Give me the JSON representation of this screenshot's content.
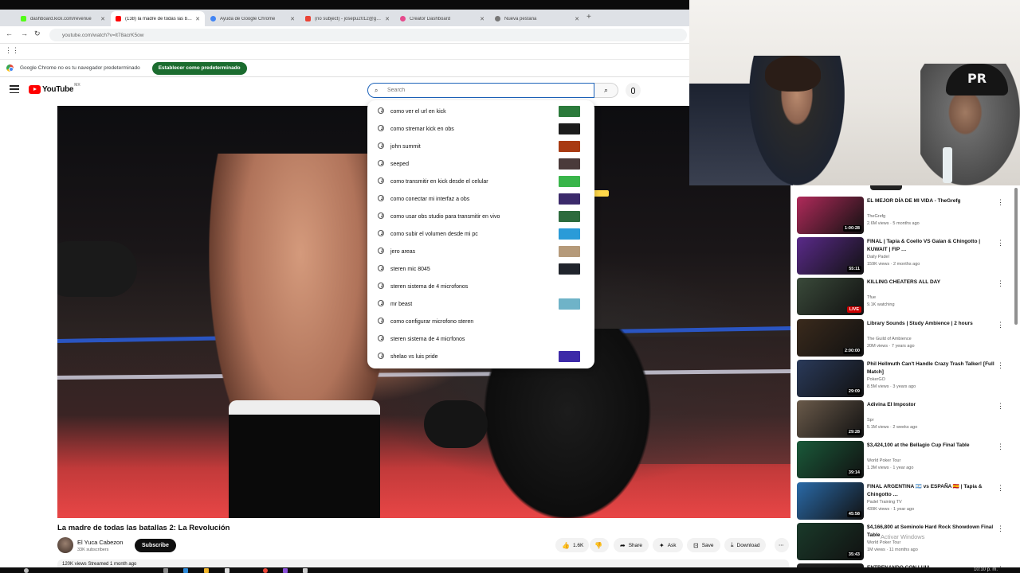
{
  "browser": {
    "tabs": [
      {
        "title": "dashboard.kick.com/revenue",
        "color": "#53fc18"
      },
      {
        "title": "(138) la madre de todas las bat…",
        "color": "#ff0000"
      },
      {
        "title": "Ayuda de Google Chrome",
        "color": "#4285f4"
      },
      {
        "title": "(no subject) - josepu2012@gm…",
        "color": "#ea4335"
      },
      {
        "title": "Creator Dashboard",
        "color": "#e64a8c"
      },
      {
        "title": "Nueva pestaña",
        "color": "#777777"
      }
    ],
    "url": "youtube.com/watch?v=lt78acrK5ow",
    "infobar": {
      "message": "Google Chrome no es tu navegador predeterminado",
      "button": "Establecer como predeterminado"
    }
  },
  "youtube": {
    "logo_text": "YouTube",
    "logo_country": "MX",
    "search": {
      "placeholder": "Search",
      "value": ""
    },
    "suggestions": [
      {
        "text": "como ver el url en kick",
        "thumb": "#2b7a3b"
      },
      {
        "text": "como stremar kick en obs",
        "thumb": "#1c1c1c"
      },
      {
        "text": "john summit",
        "thumb": "#a83a12"
      },
      {
        "text": "seeped",
        "thumb": "#4a3a3a"
      },
      {
        "text": "como transmitir en kick desde el celular",
        "thumb": "#39b54a"
      },
      {
        "text": "como conectar mi interfaz a obs",
        "thumb": "#3b2a6b"
      },
      {
        "text": "como usar obs studio para transmitir en vivo",
        "thumb": "#2d6b3d"
      },
      {
        "text": "como subir el volumen desde mi pc",
        "thumb": "#2a9bd8"
      },
      {
        "text": "jero areas",
        "thumb": "#b59a7a"
      },
      {
        "text": "steren mic 8045",
        "thumb": "#20242c"
      },
      {
        "text": "steren sistema de 4 microfonos",
        "thumb": ""
      },
      {
        "text": "mr beast",
        "thumb": "#6fb3c8"
      },
      {
        "text": "como configurar microfono steren",
        "thumb": ""
      },
      {
        "text": "steren sistema de 4 micrfonos",
        "thumb": ""
      },
      {
        "text": "shelao vs luis pride",
        "thumb": "#3d2aa8"
      }
    ],
    "video": {
      "title": "La madre de todas las batallas 2: La Revolución",
      "channel": "El Yuca Cabezon",
      "subscribers": "33K subscribers",
      "subscribe_label": "Subscribe",
      "likes": "1.6K",
      "share_label": "Share",
      "ask_label": "Ask",
      "save_label": "Save",
      "download_label": "Download",
      "views": "120K views  Streamed 1 month ago"
    },
    "recommendations": [
      {
        "title": "EL MEJOR DÍA DE MI VIDA - TheGrefg",
        "channel": "TheGrefg",
        "meta": "2.6M views · 5 months ago",
        "duration": "1:00:28",
        "thumb": "#b02a5a"
      },
      {
        "title": "FINAL | Tapia & Coello VS Galan & Chingotto | KUWAIT | FIP …",
        "channel": "Daily Padel",
        "meta": "159K views · 2 months ago",
        "duration": "55:11",
        "thumb": "#5a2a8a"
      },
      {
        "title": "KILLING CHEATERS ALL DAY",
        "channel": "Tfue",
        "meta": "9.1K watching",
        "duration": "LIVE",
        "thumb": "#3a4a3a"
      },
      {
        "title": "Library Sounds | Study Ambience | 2 hours",
        "channel": "The Guild of Ambience",
        "meta": "20M views · 7 years ago",
        "duration": "2:00:00",
        "thumb": "#3a2a1c"
      },
      {
        "title": "Phil Hellmuth Can't Handle Crazy Trash Talker! [Full Match]",
        "channel": "PokerGO",
        "meta": "8.5M views · 3 years ago",
        "duration": "29:09",
        "thumb": "#2a3a5a"
      },
      {
        "title": "Adivina El Impostor",
        "channel": "Spr",
        "meta": "5.1M views · 2 weeks ago",
        "duration": "29:28",
        "thumb": "#6a5a4a"
      },
      {
        "title": "$3,424,100 at the Bellagio Cup Final Table",
        "channel": "World Poker Tour",
        "meta": "1.3M views · 1 year ago",
        "duration": "39:14",
        "thumb": "#1a5a3a"
      },
      {
        "title": "FINAL ARGENTINA 🇦🇷 vs ESPAÑA 🇪🇸 | Tapia & Chingotto …",
        "channel": "Padel Training TV",
        "meta": "439K views · 1 year ago",
        "duration": "45:58",
        "thumb": "#2a6aa8"
      },
      {
        "title": "$4,166,800 at Seminole Hard Rock Showdown Final Table",
        "channel": "World Poker Tour",
        "meta": "1M views · 11 months ago",
        "duration": "35:43",
        "thumb": "#1a3a2a"
      },
      {
        "title": "ENTRENANDO CON LUIA",
        "channel": "",
        "meta": "",
        "duration": "",
        "thumb": "#222"
      }
    ]
  },
  "overlay": {
    "watermark": "Activar Windows",
    "webcam_cap_text": "PR",
    "clock": "10:10 p. m."
  }
}
